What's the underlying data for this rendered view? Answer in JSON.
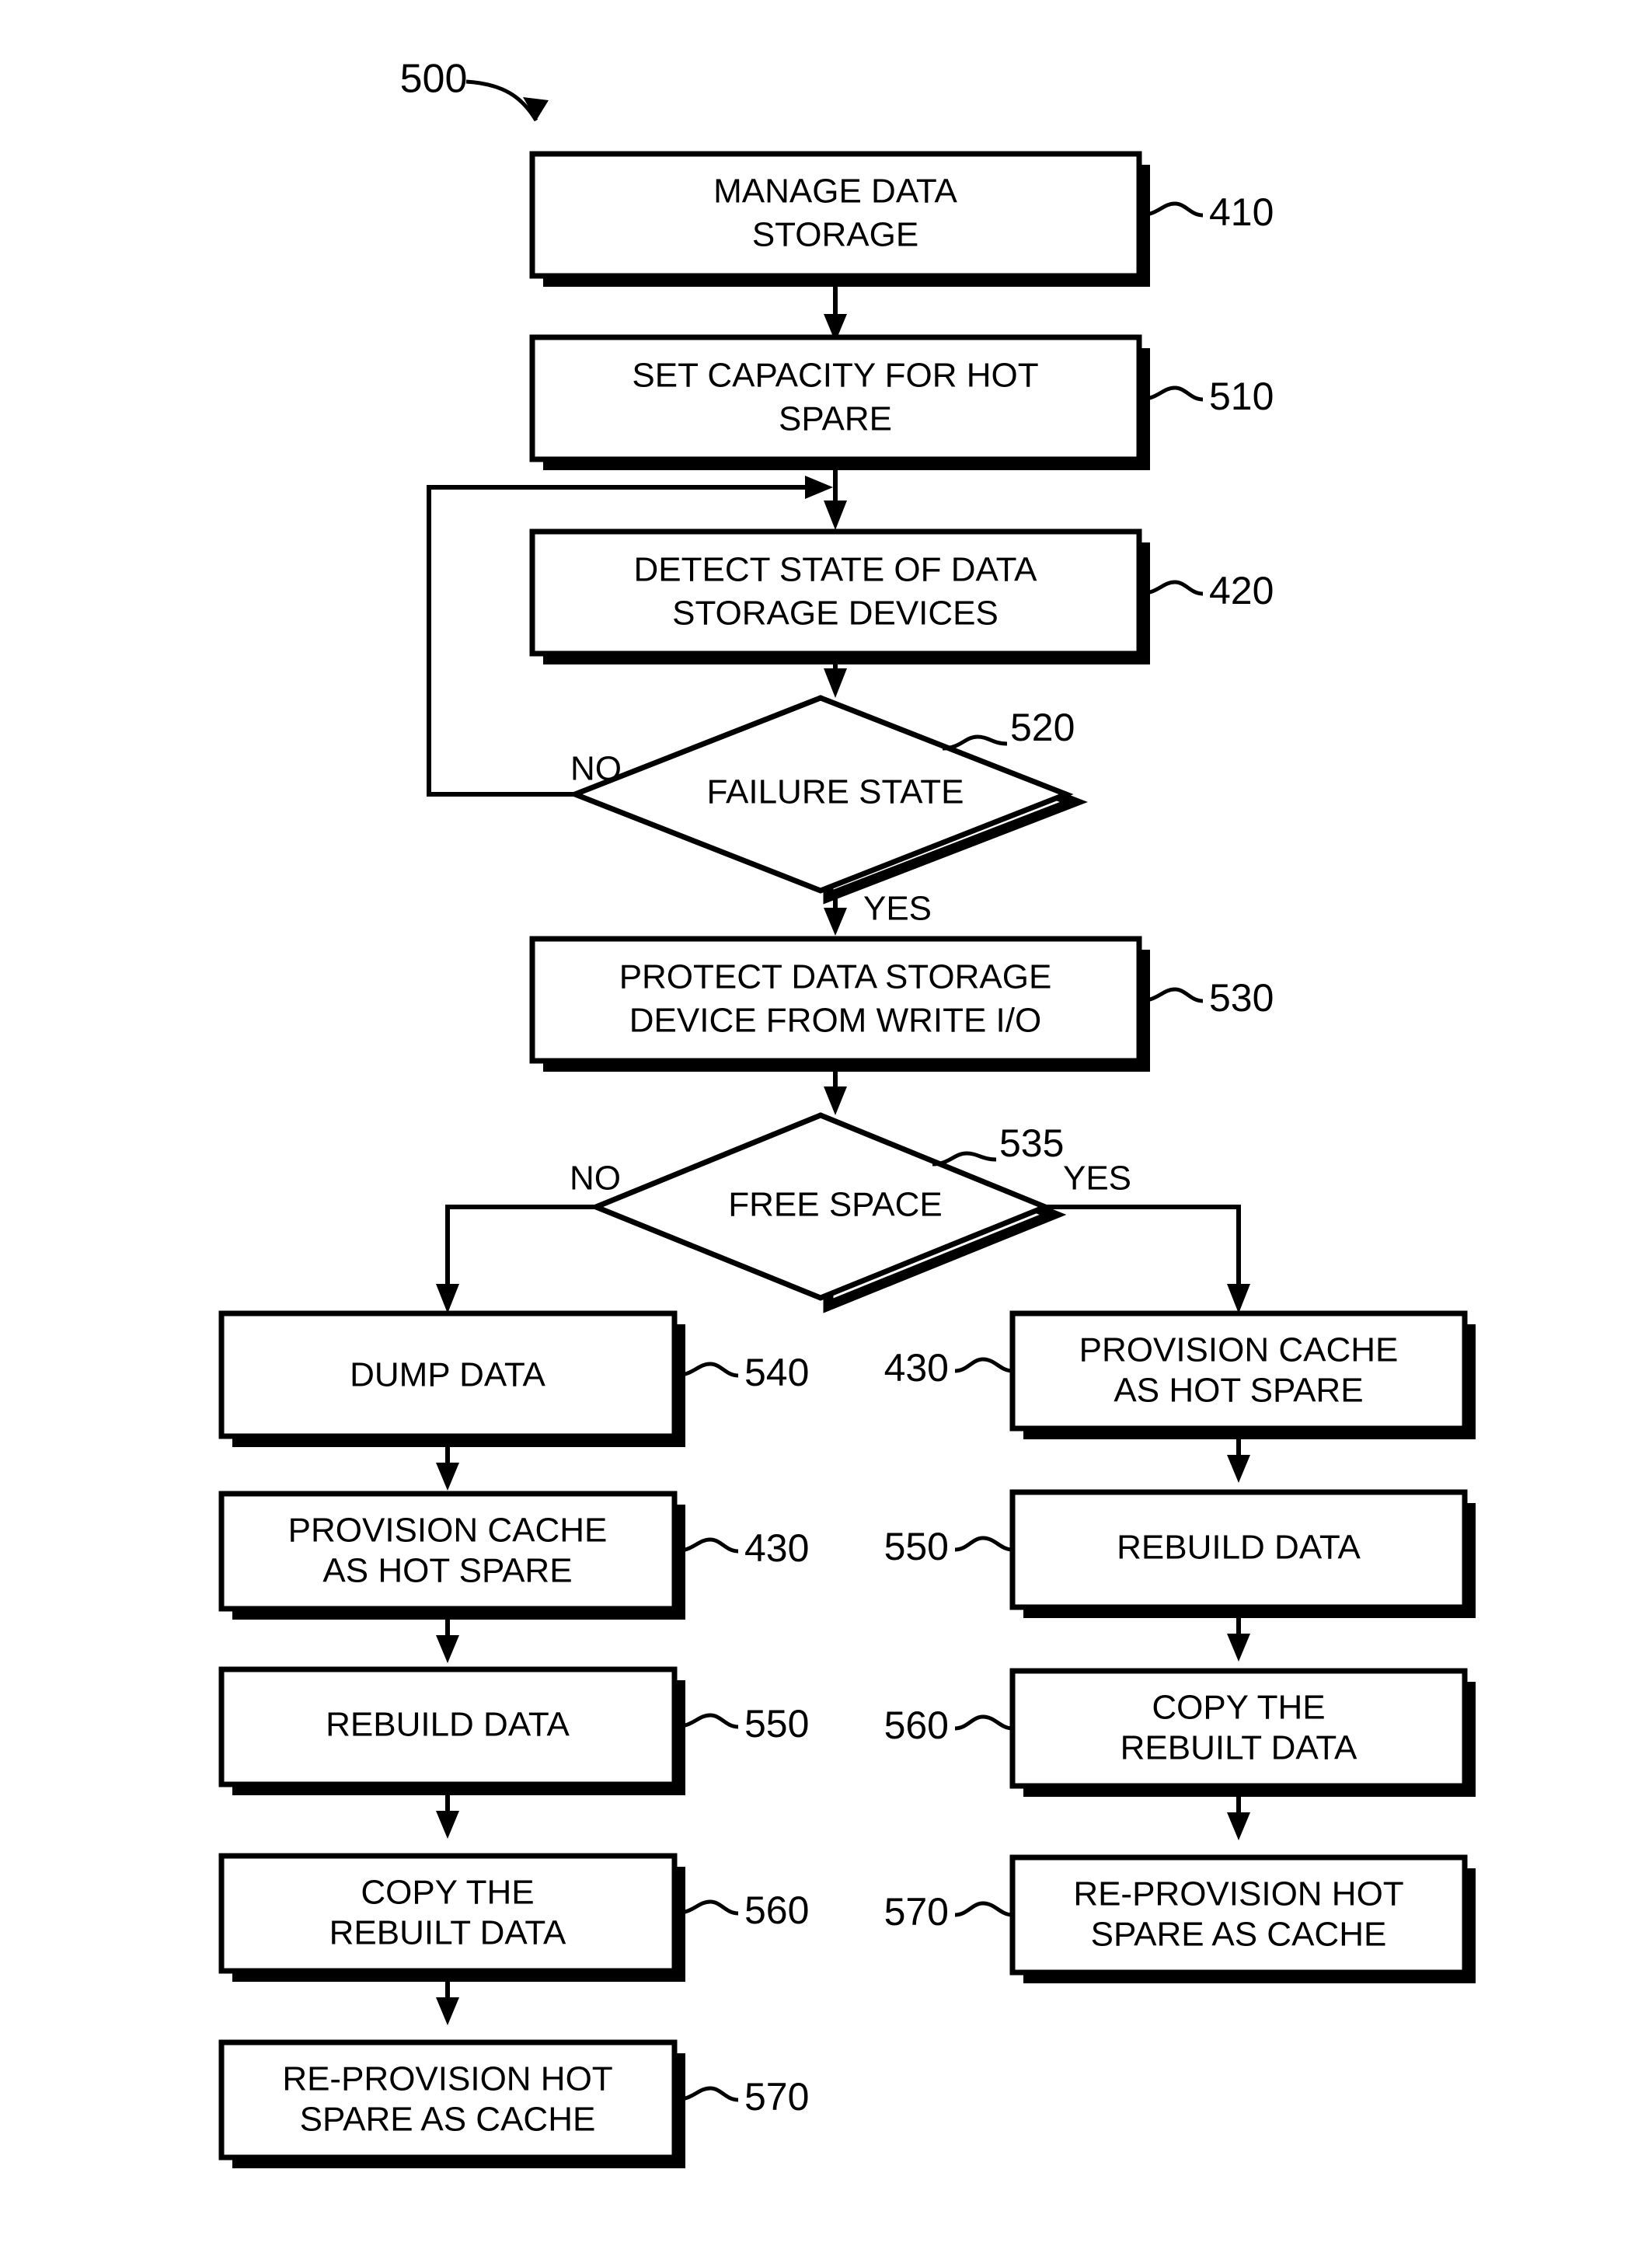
{
  "figure": {
    "number": "500",
    "type": "patent-flowchart"
  },
  "nodes": [
    {
      "id": "n410",
      "kind": "process",
      "ref": "410",
      "ref_side": "right",
      "lines": [
        "MANAGE DATA",
        "STORAGE"
      ]
    },
    {
      "id": "n510",
      "kind": "process",
      "ref": "510",
      "ref_side": "right",
      "lines": [
        "SET CAPACITY FOR HOT",
        "SPARE"
      ]
    },
    {
      "id": "n420",
      "kind": "process",
      "ref": "420",
      "ref_side": "right",
      "lines": [
        "DETECT STATE OF DATA",
        "STORAGE DEVICES"
      ]
    },
    {
      "id": "n520",
      "kind": "decision",
      "ref": "520",
      "ref_side": "right",
      "lines": [
        "FAILURE STATE"
      ]
    },
    {
      "id": "n530",
      "kind": "process",
      "ref": "530",
      "ref_side": "right",
      "lines": [
        "PROTECT DATA STORAGE",
        "DEVICE FROM WRITE I/O"
      ]
    },
    {
      "id": "n535",
      "kind": "decision",
      "ref": "535",
      "ref_side": "right",
      "lines": [
        "FREE SPACE"
      ]
    },
    {
      "id": "n540",
      "kind": "process",
      "ref": "540",
      "ref_side": "right",
      "lines": [
        "DUMP DATA"
      ]
    },
    {
      "id": "n430L",
      "kind": "process",
      "ref": "430",
      "ref_side": "right",
      "lines": [
        "PROVISION CACHE",
        "AS HOT SPARE"
      ]
    },
    {
      "id": "n550L",
      "kind": "process",
      "ref": "550",
      "ref_side": "right",
      "lines": [
        "REBUILD DATA"
      ]
    },
    {
      "id": "n560L",
      "kind": "process",
      "ref": "560",
      "ref_side": "right",
      "lines": [
        "COPY THE",
        "REBUILT DATA"
      ]
    },
    {
      "id": "n570L",
      "kind": "process",
      "ref": "570",
      "ref_side": "right",
      "lines": [
        "RE-PROVISION HOT",
        "SPARE AS CACHE"
      ]
    },
    {
      "id": "n430R",
      "kind": "process",
      "ref": "430",
      "ref_side": "left",
      "lines": [
        "PROVISION CACHE",
        "AS HOT SPARE"
      ]
    },
    {
      "id": "n550R",
      "kind": "process",
      "ref": "550",
      "ref_side": "left",
      "lines": [
        "REBUILD DATA"
      ]
    },
    {
      "id": "n560R",
      "kind": "process",
      "ref": "560",
      "ref_side": "left",
      "lines": [
        "COPY THE",
        "REBUILT DATA"
      ]
    },
    {
      "id": "n570R",
      "kind": "process",
      "ref": "570",
      "ref_side": "left",
      "lines": [
        "RE-PROVISION HOT",
        "SPARE AS CACHE"
      ]
    }
  ],
  "branch_labels": {
    "failure_no": "NO",
    "failure_yes": "YES",
    "freespace_no": "NO",
    "freespace_yes": "YES"
  },
  "colors": {
    "stroke": "#000000",
    "fill": "#ffffff",
    "background": "#ffffff"
  }
}
